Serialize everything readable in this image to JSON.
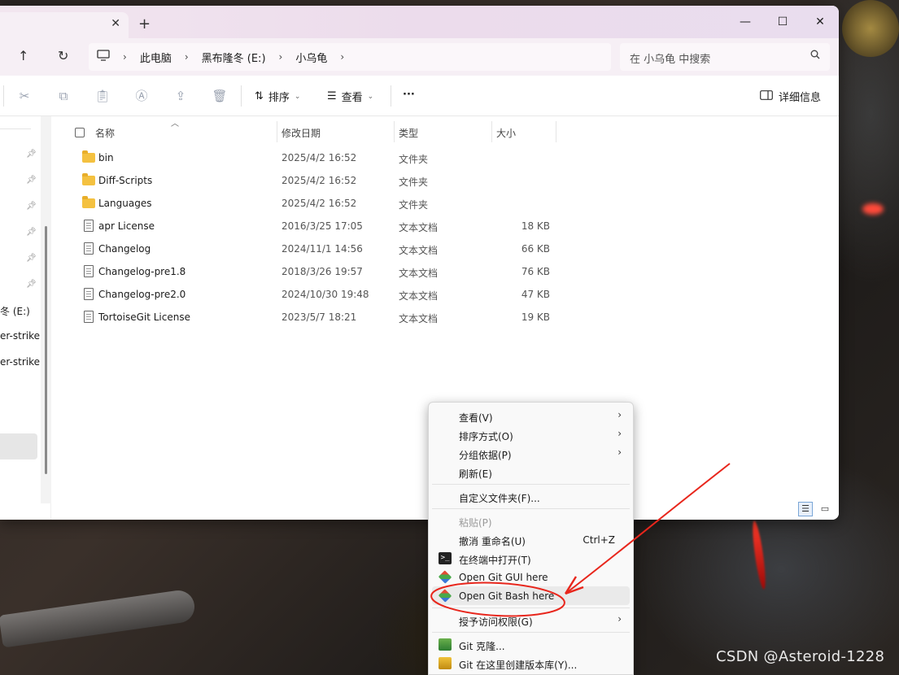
{
  "explorer": {
    "tab_close": "✕",
    "new_tab": "+",
    "window_controls": {
      "minimize": "—",
      "maximize": "☐",
      "close": "✕"
    },
    "nav": {
      "up": "↑",
      "refresh": "↻"
    },
    "breadcrumb": [
      "此电脑",
      "黑布隆冬 (E:)",
      "小乌龟"
    ],
    "search_placeholder": "在 小乌龟 中搜索",
    "toolbar": {
      "sort_label": "排序",
      "view_label": "查看",
      "more_label": "···",
      "details_label": "详细信息"
    },
    "sidebar": {
      "labels": [
        "冬 (E:)",
        "er-strike",
        "er-strike"
      ]
    },
    "columns": {
      "name": "名称",
      "modified": "修改日期",
      "type": "类型",
      "size": "大小"
    },
    "files": [
      {
        "name": "bin",
        "modified": "2025/4/2 16:52",
        "type": "文件夹",
        "size": "",
        "kind": "folder"
      },
      {
        "name": "Diff-Scripts",
        "modified": "2025/4/2 16:52",
        "type": "文件夹",
        "size": "",
        "kind": "folder"
      },
      {
        "name": "Languages",
        "modified": "2025/4/2 16:52",
        "type": "文件夹",
        "size": "",
        "kind": "folder"
      },
      {
        "name": "apr License",
        "modified": "2016/3/25 17:05",
        "type": "文本文档",
        "size": "18 KB",
        "kind": "doc"
      },
      {
        "name": "Changelog",
        "modified": "2024/11/1 14:56",
        "type": "文本文档",
        "size": "66 KB",
        "kind": "doc"
      },
      {
        "name": "Changelog-pre1.8",
        "modified": "2018/3/26 19:57",
        "type": "文本文档",
        "size": "76 KB",
        "kind": "doc"
      },
      {
        "name": "Changelog-pre2.0",
        "modified": "2024/10/30 19:48",
        "type": "文本文档",
        "size": "47 KB",
        "kind": "doc"
      },
      {
        "name": "TortoiseGit License",
        "modified": "2023/5/7 18:21",
        "type": "文本文档",
        "size": "19 KB",
        "kind": "doc"
      }
    ]
  },
  "context_menu": {
    "view": "查看(V)",
    "sort_by": "排序方式(O)",
    "group_by": "分组依据(P)",
    "refresh": "刷新(E)",
    "customize_folder": "自定义文件夹(F)...",
    "paste": "粘贴(P)",
    "undo_rename": "撤消 重命名(U)",
    "undo_shortcut": "Ctrl+Z",
    "open_in_terminal": "在终端中打开(T)",
    "open_git_gui": "Open Git GUI here",
    "open_git_bash": "Open Git Bash here",
    "give_access": "授予访问权限(G)",
    "git_clone": "Git 克隆...",
    "git_create_repo": "Git 在这里创建版本库(Y)..."
  },
  "watermark": "CSDN @Asteroid-1228",
  "colors": {
    "annotation_red": "#e8261c",
    "folder_yellow": "#f4c140",
    "titlebar_tint": "#f2e6ef"
  }
}
